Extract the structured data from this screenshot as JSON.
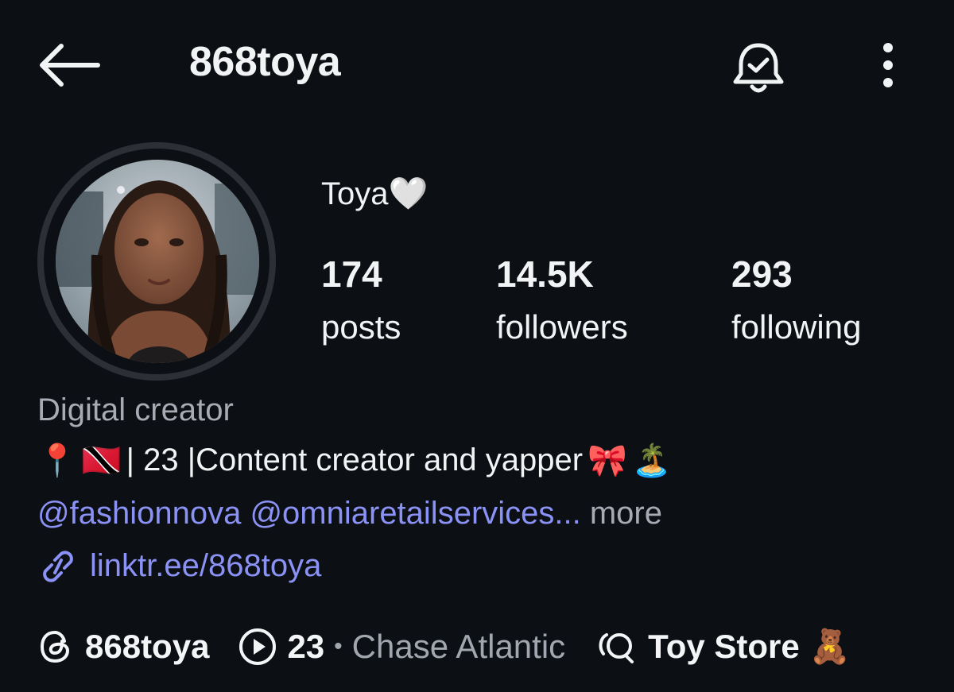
{
  "header": {
    "username": "868toya",
    "back_icon": "arrow-left-icon",
    "notify_icon": "bell-check-icon",
    "menu_icon": "vertical-dots-icon"
  },
  "profile": {
    "display_name": "Toya",
    "display_emoji": "🤍",
    "stats": [
      {
        "value": "174",
        "label": "posts"
      },
      {
        "value": "14.5K",
        "label": "followers"
      },
      {
        "value": "293",
        "label": "following"
      }
    ]
  },
  "bio": {
    "category": "Digital creator",
    "line_text": "| 23 |Content creator and yapper",
    "emojis": [
      "📍",
      "🇹🇹",
      "🎀",
      "🏝️"
    ],
    "mentions": "@fashionnova @omniaretailservices",
    "ellipsis": "...",
    "more_label": "more",
    "link_text": "linktr.ee/868toya"
  },
  "footer": {
    "threads_handle": "868toya",
    "music_count": "23",
    "separator": "•",
    "music_artist": "Chase Atlantic",
    "channel_name": "Toy Store",
    "channel_emoji": "🧸"
  },
  "colors": {
    "background": "#0c0f14",
    "link": "#8b92f5",
    "muted": "#a8abb3"
  }
}
